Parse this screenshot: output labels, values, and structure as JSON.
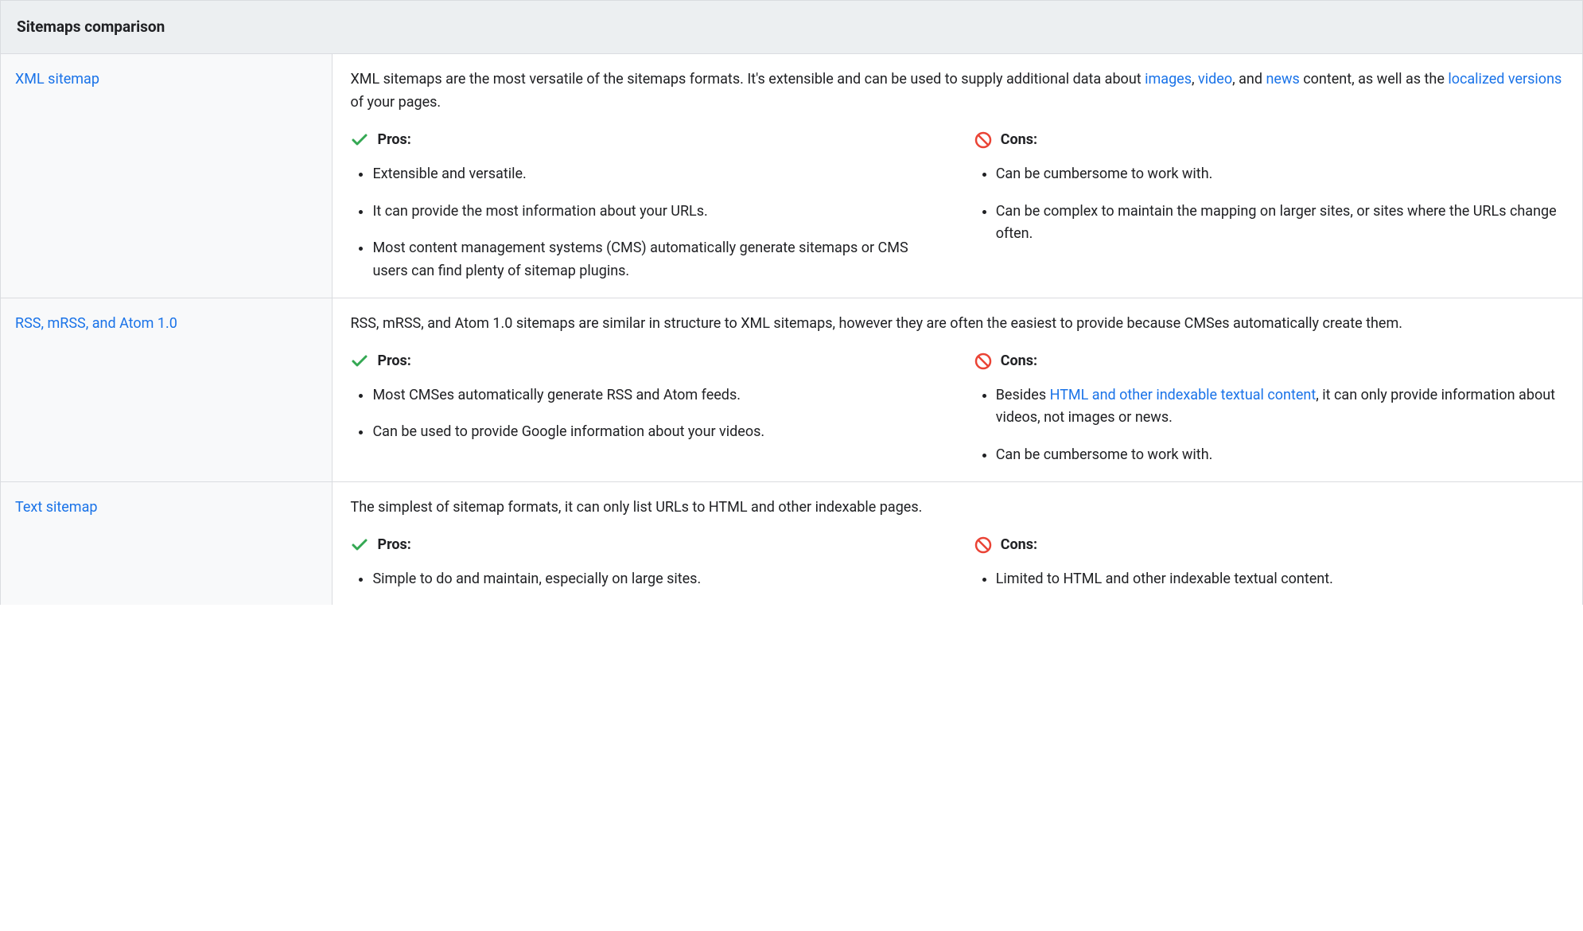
{
  "header": "Sitemaps comparison",
  "labels": {
    "pros": "Pros:",
    "cons": "Cons:"
  },
  "rows": [
    {
      "title": "XML sitemap",
      "intro_before": "XML sitemaps are the most versatile of the sitemaps formats. It's extensible and can be used to supply additional data about ",
      "links": {
        "images": "images",
        "video": "video",
        "news": "news",
        "localized": "localized versions"
      },
      "intro_sep1": ", ",
      "intro_sep2": ", and ",
      "intro_mid": " content, as well as the ",
      "intro_after": " of your pages.",
      "pros": [
        "Extensible and versatile.",
        "It can provide the most information about your URLs.",
        "Most content management systems (CMS) automatically generate sitemaps or CMS users can find plenty of sitemap plugins."
      ],
      "cons": [
        "Can be cumbersome to work with.",
        "Can be complex to maintain the mapping on larger sites, or sites where the URLs change often."
      ]
    },
    {
      "title": "RSS, mRSS, and Atom 1.0",
      "intro": "RSS, mRSS, and Atom 1.0 sitemaps are similar in structure to XML sitemaps, however they are often the easiest to provide because CMSes automatically create them.",
      "pros": [
        "Most CMSes automatically generate RSS and Atom feeds.",
        "Can be used to provide Google information about your videos."
      ],
      "cons_0_before": "Besides ",
      "cons_0_link": "HTML and other indexable textual content",
      "cons_0_after": ", it can only provide information about videos, not images or news.",
      "cons_1": "Can be cumbersome to work with."
    },
    {
      "title": "Text sitemap",
      "intro": "The simplest of sitemap formats, it can only list URLs to HTML and other indexable pages.",
      "pros": [
        "Simple to do and maintain, especially on large sites."
      ],
      "cons": [
        "Limited to HTML and other indexable textual content."
      ]
    }
  ]
}
